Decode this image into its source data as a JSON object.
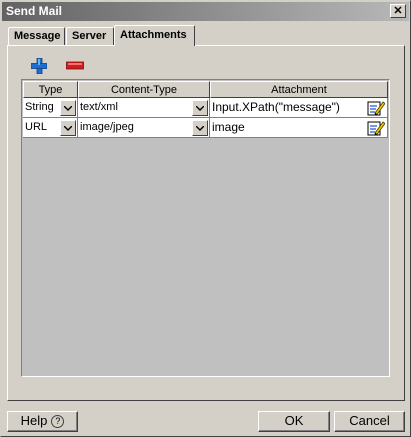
{
  "window": {
    "title": "Send Mail",
    "close_label": "✕"
  },
  "tabs": [
    {
      "label": "Message",
      "active": false
    },
    {
      "label": "Server",
      "active": false
    },
    {
      "label": "Attachments",
      "active": true
    }
  ],
  "toolbar": {
    "add_icon": "add-plus-icon",
    "remove_icon": "remove-minus-icon"
  },
  "table": {
    "headers": [
      "Type",
      "Content-Type",
      "Attachment"
    ],
    "rows": [
      {
        "type": "String",
        "content_type": "text/xml",
        "attachment": "Input.XPath(\"message\")"
      },
      {
        "type": "URL",
        "content_type": "image/jpeg",
        "attachment": "image"
      }
    ]
  },
  "buttons": {
    "help": "Help",
    "help_icon": "?",
    "ok": "OK",
    "cancel": "Cancel"
  },
  "colors": {
    "title_start": "#626262",
    "title_end": "#b8b8b8",
    "face": "#d4d0c8",
    "grid_bg": "#c0c0c0"
  }
}
